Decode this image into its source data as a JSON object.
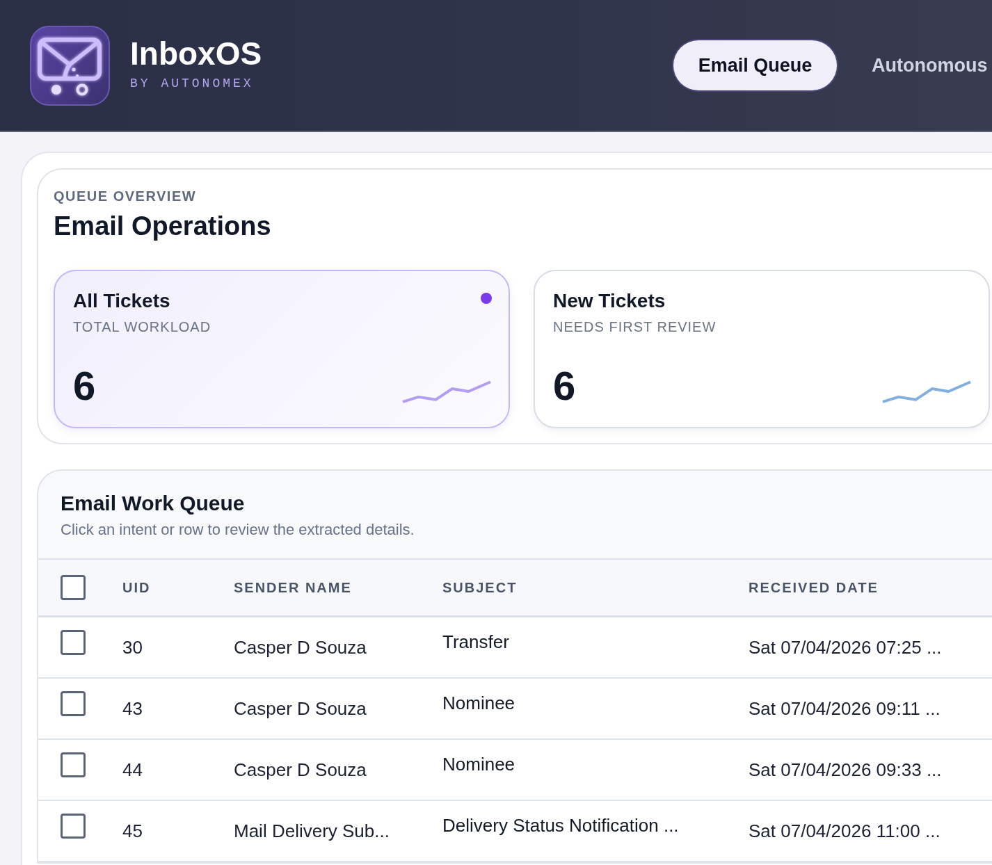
{
  "header": {
    "app_name": "InboxOS",
    "byline": "BY AUTONOMEX",
    "nav": [
      {
        "label": "Email Queue",
        "selected": true
      },
      {
        "label": "Autonomous",
        "selected": false
      }
    ]
  },
  "overview": {
    "eyebrow": "QUEUE OVERVIEW",
    "title": "Email Operations",
    "stats": [
      {
        "title": "All Tickets",
        "subtitle": "TOTAL WORKLOAD",
        "value": "6",
        "selected": true
      },
      {
        "title": "New Tickets",
        "subtitle": "NEEDS FIRST REVIEW",
        "value": "6",
        "selected": false
      }
    ]
  },
  "queue": {
    "title": "Email Work Queue",
    "subtitle": "Click an intent or row to review the extracted details.",
    "select_all_checked": false,
    "columns": [
      "UID",
      "SENDER NAME",
      "SUBJECT",
      "RECEIVED DATE"
    ],
    "rows": [
      {
        "checked": false,
        "cells": [
          "30",
          "Casper D Souza",
          "Transfer",
          "Sat 07/04/2026 07:25 ..."
        ]
      },
      {
        "checked": false,
        "cells": [
          "43",
          "Casper D Souza",
          "Nominee",
          "Sat 07/04/2026 09:11 ..."
        ]
      },
      {
        "checked": false,
        "cells": [
          "44",
          "Casper D Souza",
          "Nominee",
          "Sat 07/04/2026 09:33 ..."
        ]
      },
      {
        "checked": false,
        "cells": [
          "45",
          "Mail Delivery Sub...",
          "Delivery Status Notification ...",
          "Sat 07/04/2026 11:00 ..."
        ]
      }
    ]
  }
}
